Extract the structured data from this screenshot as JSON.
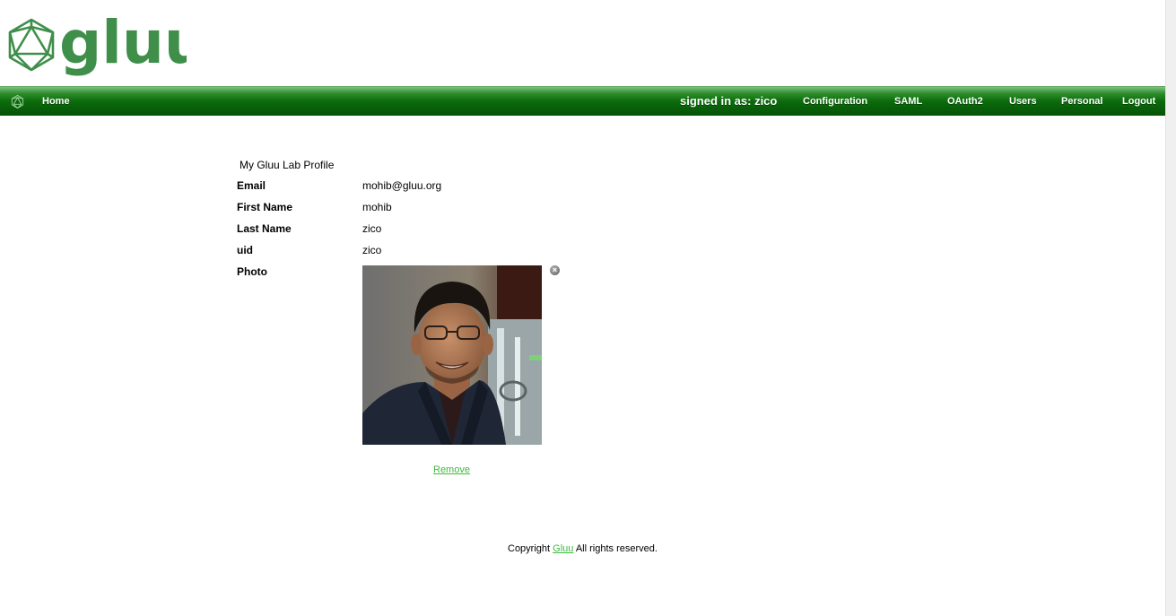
{
  "header": {
    "logo_text": "gluu"
  },
  "navbar": {
    "home": "Home",
    "signed_in": "signed in as: zico",
    "items": [
      "Configuration",
      "SAML",
      "OAuth2",
      "Users",
      "Personal",
      "Logout"
    ]
  },
  "profile": {
    "title": "My Gluu Lab Profile",
    "fields": [
      {
        "label": "Email",
        "value": "mohib@gluu.org"
      },
      {
        "label": "First Name",
        "value": "mohib"
      },
      {
        "label": "Last Name",
        "value": "zico"
      },
      {
        "label": "uid",
        "value": "zico"
      },
      {
        "label": "Photo",
        "value": ""
      }
    ],
    "remove_label": "Remove"
  },
  "footer": {
    "prefix": "Copyright ",
    "link": "Gluu",
    "suffix": " All rights reserved."
  },
  "colors": {
    "brand_green": "#3f8f4b",
    "nav_green": "#0b6b0b",
    "link_green": "#3dbb3d"
  }
}
